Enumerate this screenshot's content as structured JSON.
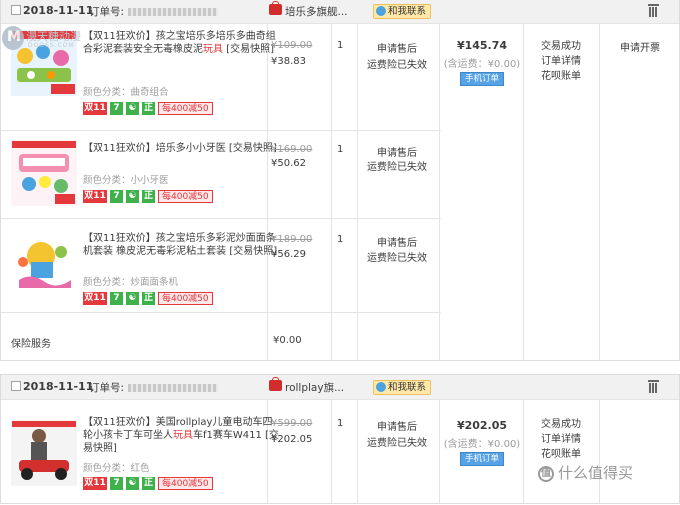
{
  "orders": [
    {
      "date": "2018-11-11",
      "order_label": "订单号:",
      "shop": "培乐多旗舰...",
      "contact": "和我联系",
      "items": [
        {
          "title_pre": "【双11狂欢价】孩之宝培乐多培乐多曲奇组合彩泥套装安全无毒橡皮泥",
          "title_kw": "玩具",
          "title_post": " [交易快照]",
          "variant": "颜色分类：曲奇组合",
          "tags": [
            "双11",
            "7",
            "",
            "正",
            "每400减50"
          ],
          "orig_price": "¥109.00",
          "price": "¥38.83",
          "qty": "1",
          "after_sale": "申请售后",
          "refund": "运费险已失效"
        },
        {
          "title_pre": "【双11狂欢价】培乐多小小牙医",
          "title_kw": "",
          "title_post": " [交易快照]",
          "variant": "颜色分类：小小牙医",
          "tags": [
            "双11",
            "7",
            "",
            "正",
            "每400减50"
          ],
          "orig_price": "¥169.00",
          "price": "¥50.62",
          "qty": "1",
          "after_sale": "申请售后",
          "refund": "运费险已失效"
        },
        {
          "title_pre": "【双11狂欢价】孩之宝培乐多彩泥炒面面条机套装 橡皮泥无毒彩泥粘土套装",
          "title_kw": "",
          "title_post": " [交易快照]",
          "variant": "颜色分类：炒面面条机",
          "tags": [
            "双11",
            "7",
            "",
            "正",
            "每400减50"
          ],
          "orig_price": "¥189.00",
          "price": "¥56.29",
          "qty": "1",
          "after_sale": "申请售后",
          "refund": "运费险已失效"
        }
      ],
      "insurance_label": "保险服务",
      "insurance_price": "¥0.00",
      "total": "¥145.74",
      "shipping": "(含运费：¥0.00)",
      "mobile_order": "手机订单",
      "status": [
        "交易成功",
        "订单详情",
        "花呗账单"
      ],
      "invoice": "申请开票"
    },
    {
      "date": "2018-11-11",
      "order_label": "订单号:",
      "shop": "rollplay旗...",
      "contact": "和我联系",
      "items": [
        {
          "title_pre": "【双11狂欢价】美国rollplay儿童电动车四轮小孩卡丁车可坐人",
          "title_kw": "玩具",
          "title_post": "车f1赛车W411 [交易快照]",
          "variant": "颜色分类：红色",
          "tags": [
            "双11",
            "7",
            "",
            "正",
            "每400减50"
          ],
          "orig_price": "¥599.00",
          "price": "¥202.05",
          "qty": "1",
          "after_sale": "申请售后",
          "refund": "运费险已失效"
        }
      ],
      "total": "¥202.05",
      "shipping": "(含运费：¥0.00)",
      "mobile_order": "手机订单",
      "status": [
        "交易成功",
        "订单详情",
        "花呗账单"
      ]
    }
  ],
  "watermarks": {
    "top_left_line1": "漫天糖动漫",
    "top_left_line2": "DOOSS.COM",
    "bottom_right": "什么值得买",
    "bottom_right_mark": "值"
  },
  "colors": {
    "accent_red": "#e4393c",
    "tag_green": "#3fb14b",
    "button_blue": "#56a2e6",
    "header_bg": "#f1f1f1"
  }
}
